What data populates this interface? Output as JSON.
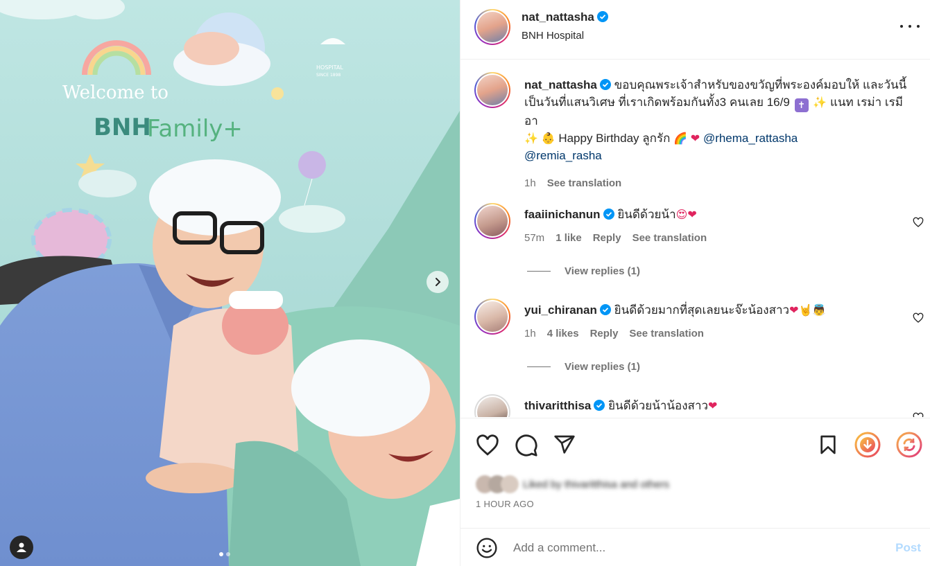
{
  "post": {
    "author": "nat_nattasha",
    "location": "BNH Hospital",
    "photo_signage": {
      "welcome": "Welcome to",
      "brand": "BNH",
      "brand_suffix": "Family+",
      "hospital": "HOSPITAL",
      "since": "SINCE 1898"
    },
    "carousel": {
      "current": 1,
      "total": 2
    }
  },
  "caption": {
    "username": "nat_nattasha",
    "text_1": "ขอบคุณพระเจ้าสำหรับของขวัญที่พระองค์มอบให้ และวันนี้เป็นวันที่แสนวิเศษ ที่เราเกิดพร้อมกันทั้ง3 คนเลย 16/9",
    "text_2": "แนท เรม่า เรมีอา",
    "text_3": "Happy Birthday ลูกรัก",
    "emoji_1": "✨",
    "emoji_2": "👶",
    "emoji_3": "🌈",
    "emoji_4": "❤",
    "cross": "✝",
    "mention_1": "@rhema_rattasha",
    "mention_2": "@remia_rasha",
    "time": "1h",
    "see_translation": "See translation"
  },
  "comments": [
    {
      "username": "faaiinichanun",
      "text": "ยินดีด้วยน้า",
      "emoji": "😍❤",
      "time": "57m",
      "likes": "1 like",
      "reply": "Reply",
      "translation": "See translation",
      "view_replies": "View replies (1)"
    },
    {
      "username": "yui_chiranan",
      "text": "ยินดีด้วยมากที่สุดเลยนะจ๊ะน้องสาว",
      "emoji": "❤🤘👼",
      "time": "1h",
      "likes": "4 likes",
      "reply": "Reply",
      "translation": "See translation",
      "view_replies": "View replies (1)"
    },
    {
      "username": "thivaritthisa",
      "text": "ยินดีด้วยน้าน้องสาว",
      "emoji": "❤"
    }
  ],
  "likes_summary": "Liked by thivaritthisa and others",
  "time_ago": "1 HOUR AGO",
  "add_comment": {
    "placeholder": "Add a comment...",
    "post_label": "Post"
  },
  "colors": {
    "accent_blue": "#0095f6",
    "mention": "#00376b",
    "verified": "#0095f6",
    "post_disabled": "#b3dbff"
  },
  "icons": [
    "heart-icon",
    "comment-icon",
    "share-icon",
    "bookmark-icon",
    "download-icon",
    "repost-icon",
    "emoji-icon",
    "more-icon",
    "chevron-right-icon",
    "user-tag-icon"
  ]
}
